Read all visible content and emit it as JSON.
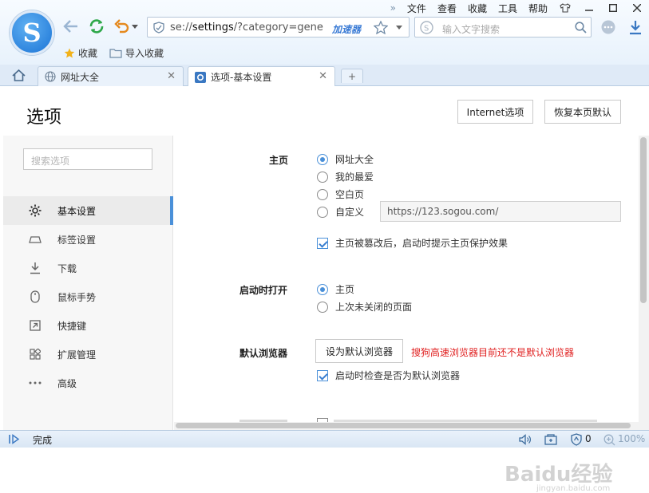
{
  "menubar": {
    "items": [
      "文件",
      "查看",
      "收藏",
      "工具",
      "帮助"
    ]
  },
  "address": {
    "url_prefix": "se://",
    "url_main": "settings",
    "url_suffix": "/?category=gene",
    "speed_label": "加速器"
  },
  "search": {
    "placeholder": "输入文字搜索"
  },
  "favbar": {
    "items": [
      "收藏",
      "导入收藏"
    ]
  },
  "tabs": [
    {
      "label": "网址大全"
    },
    {
      "label": "选项-基本设置"
    }
  ],
  "page": {
    "title": "选项",
    "internet_options": "Internet选项",
    "restore_defaults": "恢复本页默认"
  },
  "sidebar": {
    "search_placeholder": "搜索选项",
    "items": [
      {
        "label": "基本设置",
        "icon": "gear-icon"
      },
      {
        "label": "标签设置",
        "icon": "tab-icon"
      },
      {
        "label": "下载",
        "icon": "download-icon"
      },
      {
        "label": "鼠标手势",
        "icon": "mouse-icon"
      },
      {
        "label": "快捷键",
        "icon": "shortcut-icon"
      },
      {
        "label": "扩展管理",
        "icon": "extensions-icon"
      },
      {
        "label": "高级",
        "icon": "more-icon"
      }
    ]
  },
  "homepage": {
    "label": "主页",
    "options": [
      "网址大全",
      "我的最爱",
      "空白页",
      "自定义"
    ],
    "selected": "网址大全",
    "custom_url": "https://123.sogou.com/",
    "protect_label": "主页被篡改后，启动时提示主页保护效果",
    "protect_checked": true
  },
  "startup": {
    "label": "启动时打开",
    "options": [
      "主页",
      "上次未关闭的页面"
    ],
    "selected": "主页"
  },
  "default_browser": {
    "label": "默认浏览器",
    "button": "设为默认浏览器",
    "warning": "搜狗高速浏览器目前还不是默认浏览器",
    "check_label": "启动时检查是否为默认浏览器",
    "check_checked": true
  },
  "status": {
    "text": "完成",
    "count": "0",
    "zoom": "100%"
  },
  "watermark": {
    "text": "Baidu经验",
    "sub": "jingyan.baidu.com"
  },
  "colors": {
    "accent": "#4a90d9",
    "warning": "#e02020",
    "refresh": "#2ea84a",
    "back": "#e58a1f"
  }
}
